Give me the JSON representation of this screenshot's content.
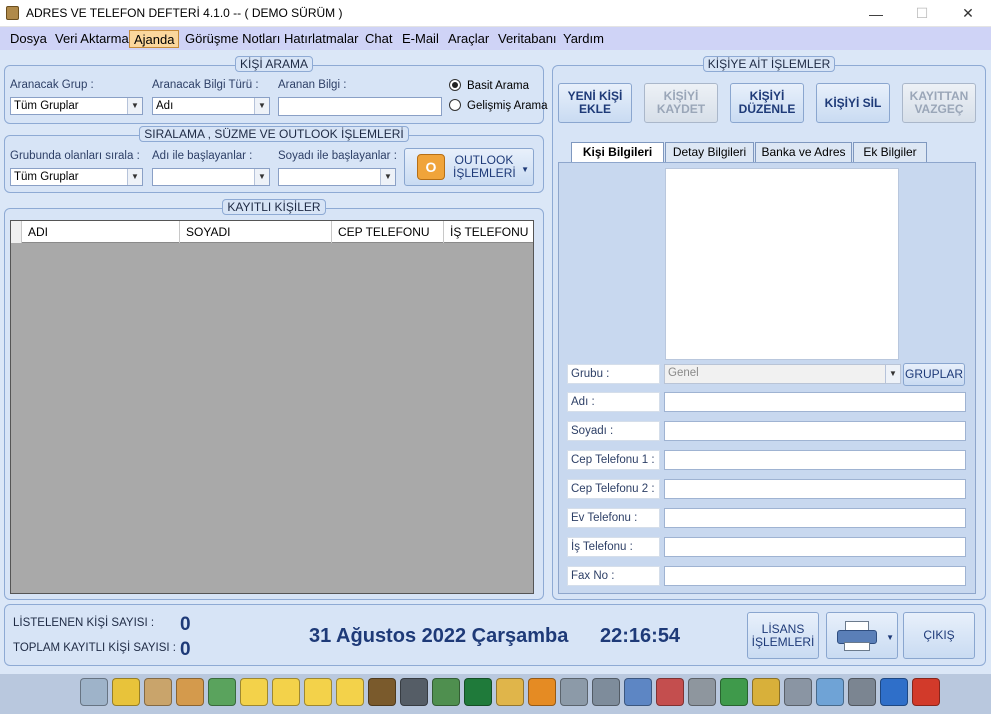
{
  "window": {
    "title": "ADRES VE TELEFON DEFTERİ  4.1.0 -- ( DEMO SÜRÜM )",
    "min_glyph": "—",
    "max_glyph": "☐",
    "close_glyph": "✕"
  },
  "menu": [
    "Dosya",
    "Veri Aktarma",
    "Ajanda",
    "Görüşme Notları",
    "Hatırlatmalar",
    "Chat",
    "E-Mail",
    "Araçlar",
    "Veritabanı",
    "Yardım"
  ],
  "menu_active": "Ajanda",
  "search": {
    "title": "KİŞİ ARAMA",
    "group_label": "Aranacak Grup :",
    "group_value": "Tüm Gruplar",
    "type_label": "Aranacak Bilgi Türü :",
    "type_value": "Adı",
    "query_label": "Aranan Bilgi :",
    "query_value": "",
    "radio_basic": "Basit Arama",
    "radio_advanced": "Gelişmiş Arama",
    "selected": "basic"
  },
  "sort": {
    "title": "SIRALAMA , SÜZME VE OUTLOOK İŞLEMLERİ",
    "group_sort_label": "Grubunda olanları sırala :",
    "group_sort_value": "Tüm Gruplar",
    "name_filter_label": "Adı ile başlayanlar :",
    "name_filter_value": "",
    "surname_filter_label": "Soyadı ile başlayanlar :",
    "surname_filter_value": "",
    "outlook_line1": "OUTLOOK",
    "outlook_line2": "İŞLEMLERİ"
  },
  "contacts": {
    "title": "KAYITLI KİŞİLER",
    "columns": [
      "ADI",
      "SOYADI",
      "CEP TELEFONU",
      "İŞ TELEFONU"
    ],
    "rows": []
  },
  "actions": {
    "title": "KİŞİYE AİT İŞLEMLER",
    "new_l1": "YENİ KİŞİ",
    "new_l2": "EKLE",
    "save_l1": "KİŞİYİ",
    "save_l2": "KAYDET",
    "edit_l1": "KİŞİYİ",
    "edit_l2": "DÜZENLE",
    "delete": "KİŞİYİ SİL",
    "cancel_l1": "KAYITTAN",
    "cancel_l2": "VAZGEÇ"
  },
  "tabs": [
    "Kişi Bilgileri",
    "Detay Bilgileri",
    "Banka ve Adres",
    "Ek Bilgiler"
  ],
  "details": {
    "group_label": "Grubu :",
    "group_value": "Genel",
    "groups_button": "GRUPLAR",
    "fields": [
      {
        "label": "Adı :",
        "value": ""
      },
      {
        "label": "Soyadı :",
        "value": ""
      },
      {
        "label": "Cep Telefonu 1 :",
        "value": ""
      },
      {
        "label": "Cep Telefonu 2 :",
        "value": ""
      },
      {
        "label": "Ev Telefonu :",
        "value": ""
      },
      {
        "label": "İş Telefonu :",
        "value": ""
      },
      {
        "label": "Fax No :",
        "value": ""
      }
    ]
  },
  "status": {
    "listed_label": "LİSTELENEN KİŞİ SAYISI :",
    "listed_value": "0",
    "total_label": "TOPLAM KAYITLI KİŞİ SAYISI :",
    "total_value": "0",
    "date": "31 Ağustos 2022 Çarşamba",
    "time": "22:16:54",
    "license_l1": "LİSANS",
    "license_l2": "İŞLEMLERİ",
    "exit": "ÇIKIŞ"
  },
  "taskbar_icons": [
    {
      "name": "note-page-icon",
      "color": "#9eb3c9"
    },
    {
      "name": "notepad-icon",
      "color": "#e8c33a"
    },
    {
      "name": "calendar-icon",
      "color": "#c9a46b"
    },
    {
      "name": "contacts-icon",
      "color": "#d49a4c"
    },
    {
      "name": "mail-check-icon",
      "color": "#5aa35d"
    },
    {
      "name": "sticky-note-1-icon",
      "color": "#f3d24a"
    },
    {
      "name": "sticky-note-2-icon",
      "color": "#f3d24a"
    },
    {
      "name": "sticky-note-3-icon",
      "color": "#f3d24a"
    },
    {
      "name": "sticky-note-4-icon",
      "color": "#f3d24a"
    },
    {
      "name": "book-icon",
      "color": "#7a5a2c"
    },
    {
      "name": "settings-gear-icon",
      "color": "#555d66"
    },
    {
      "name": "spreadsheet-icon",
      "color": "#4f8f4f"
    },
    {
      "name": "excel-icon",
      "color": "#1f7a3a"
    },
    {
      "name": "envelope-icon",
      "color": "#e0b54a"
    },
    {
      "name": "outlook-icon",
      "color": "#e58b23"
    },
    {
      "name": "phone-icon",
      "color": "#8c9aa8"
    },
    {
      "name": "satellite-icon",
      "color": "#7e8c9b"
    },
    {
      "name": "id-card-icon",
      "color": "#5d86c4"
    },
    {
      "name": "disk-icon",
      "color": "#c44e4e"
    },
    {
      "name": "scanner-icon",
      "color": "#8e969e"
    },
    {
      "name": "users-online-icon",
      "color": "#3f9a4b"
    },
    {
      "name": "key-icon",
      "color": "#d8b03a"
    },
    {
      "name": "fax-icon",
      "color": "#8a95a3"
    },
    {
      "name": "box-icon",
      "color": "#6fa3d6"
    },
    {
      "name": "printer-icon",
      "color": "#7b8591"
    },
    {
      "name": "info-icon",
      "color": "#2f6fc9"
    },
    {
      "name": "power-icon",
      "color": "#d23a2a"
    }
  ]
}
